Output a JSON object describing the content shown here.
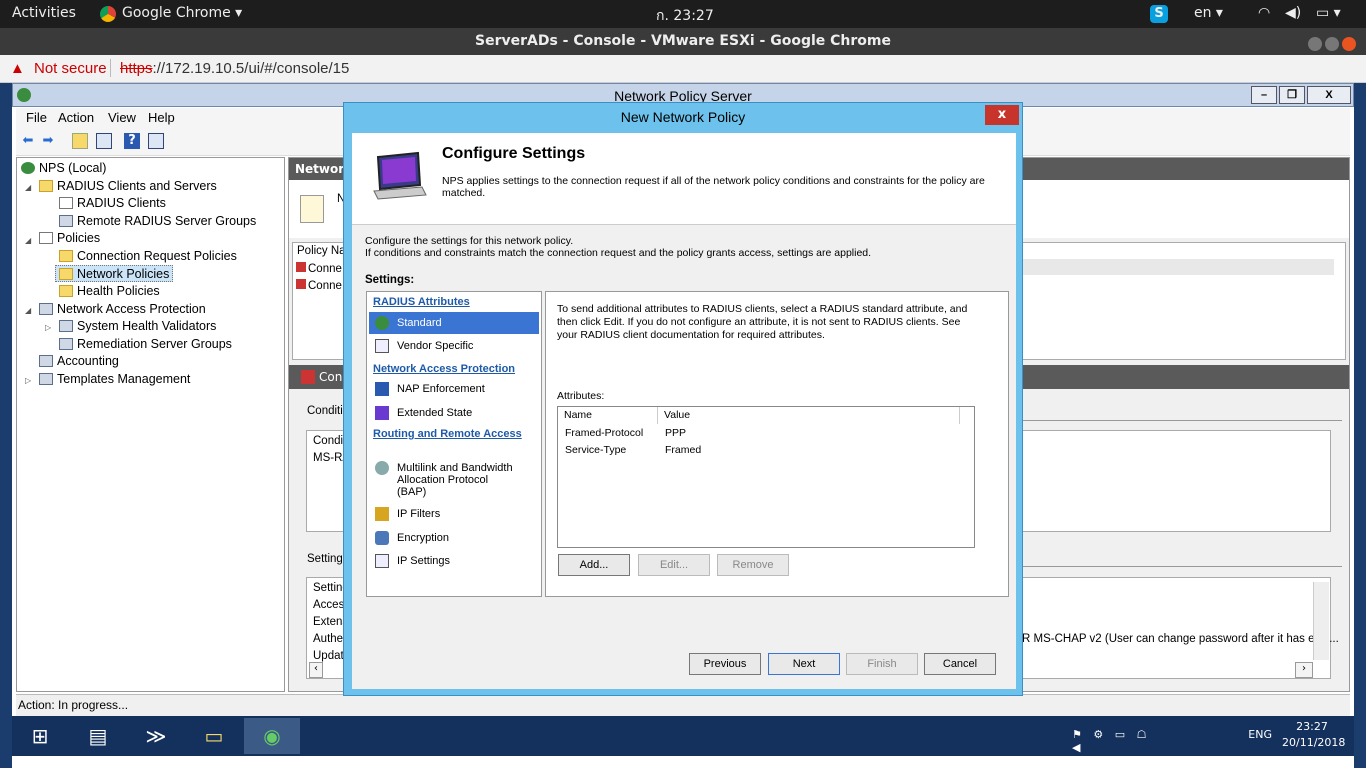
{
  "gnome_bar": {
    "activities": "Activities",
    "app": "Google Chrome ▾",
    "clock": "ก. 23:27",
    "lang": "en ▾"
  },
  "chrome": {
    "window_title": "ServerADs - Console - VMware ESXi - Google Chrome",
    "not_secure": "Not secure",
    "url_scheme": "https",
    "url_rest": "://172.19.10.5/ui/#/console/15"
  },
  "nps": {
    "title": "Network Policy Server",
    "menu": [
      "File",
      "Action",
      "View",
      "Help"
    ],
    "tree": [
      {
        "label": "NPS (Local)",
        "icon": "server-icon",
        "indent": 0,
        "expander": ""
      },
      {
        "label": "RADIUS Clients and Servers",
        "icon": "folder-icon",
        "indent": 1,
        "expander": "◢"
      },
      {
        "label": "RADIUS Clients",
        "icon": "clients-icon",
        "indent": 2,
        "expander": ""
      },
      {
        "label": "Remote RADIUS Server Groups",
        "icon": "server-groups-icon",
        "indent": 2,
        "expander": ""
      },
      {
        "label": "Policies",
        "icon": "policies-icon",
        "indent": 1,
        "expander": "◢"
      },
      {
        "label": "Connection Request Policies",
        "icon": "folder-icon",
        "indent": 2,
        "expander": ""
      },
      {
        "label": "Network Policies",
        "icon": "folder-icon",
        "indent": 2,
        "expander": "",
        "selected": true
      },
      {
        "label": "Health Policies",
        "icon": "folder-icon",
        "indent": 2,
        "expander": ""
      },
      {
        "label": "Network Access Protection",
        "icon": "nap-icon",
        "indent": 1,
        "expander": "◢"
      },
      {
        "label": "System Health Validators",
        "icon": "validators-icon",
        "indent": 2,
        "expander": "▷"
      },
      {
        "label": "Remediation Server Groups",
        "icon": "server-groups-icon",
        "indent": 2,
        "expander": ""
      },
      {
        "label": "Accounting",
        "icon": "accounting-icon",
        "indent": 1,
        "expander": ""
      },
      {
        "label": "Templates Management",
        "icon": "templates-icon",
        "indent": 1,
        "expander": "▷"
      }
    ],
    "right": {
      "header": "Network",
      "n_label": "N",
      "policy_name_col": "Policy Nar",
      "rows": [
        "Conne",
        "Conne"
      ],
      "section_header": "Conn",
      "conditions_label": "Conditio",
      "cond_col": "Conditi",
      "cond_row": "MS-RA",
      "settings_label": "Settings",
      "settings_rows": [
        "Setting",
        "Acces",
        "Extens",
        "Auther",
        "Update"
      ],
      "auth_overflow": "R MS-CHAP v2 (User can change password after it has expi..."
    },
    "status": "Action:  In progress..."
  },
  "dialog": {
    "title": "New Network Policy",
    "close": "x",
    "heading": "Configure Settings",
    "description": "NPS applies settings to the connection request if all of the network policy conditions and constraints for the policy are matched.",
    "intro_line1": "Configure the settings for this network policy.",
    "intro_line2": "If conditions and constraints match the connection request and the policy grants access, settings are applied.",
    "settings_label": "Settings:",
    "nav": {
      "radius_header": "RADIUS Attributes",
      "standard": "Standard",
      "vendor": "Vendor Specific",
      "nap_header": "Network Access Protection",
      "nap_enforcement": "NAP Enforcement",
      "extended_state": "Extended State",
      "rra_header": "Routing and Remote Access",
      "multilink": "Multilink and Bandwidth Allocation Protocol (BAP)",
      "ip_filters": "IP Filters",
      "encryption": "Encryption",
      "ip_settings": "IP Settings"
    },
    "content_text": "To send additional attributes to RADIUS clients, select a RADIUS standard attribute, and then click Edit. If you do not configure an attribute, it is not sent to RADIUS clients. See your RADIUS client documentation for required attributes.",
    "attributes_label": "Attributes:",
    "columns": [
      "Name",
      "Value"
    ],
    "attributes": [
      {
        "name": "Framed-Protocol",
        "value": "PPP"
      },
      {
        "name": "Service-Type",
        "value": "Framed"
      }
    ],
    "buttons": {
      "add": "Add...",
      "edit": "Edit...",
      "remove": "Remove",
      "previous": "Previous",
      "next": "Next",
      "finish": "Finish",
      "cancel": "Cancel"
    }
  },
  "taskbar": {
    "lang": "ENG",
    "time": "23:27",
    "date": "20/11/2018"
  }
}
